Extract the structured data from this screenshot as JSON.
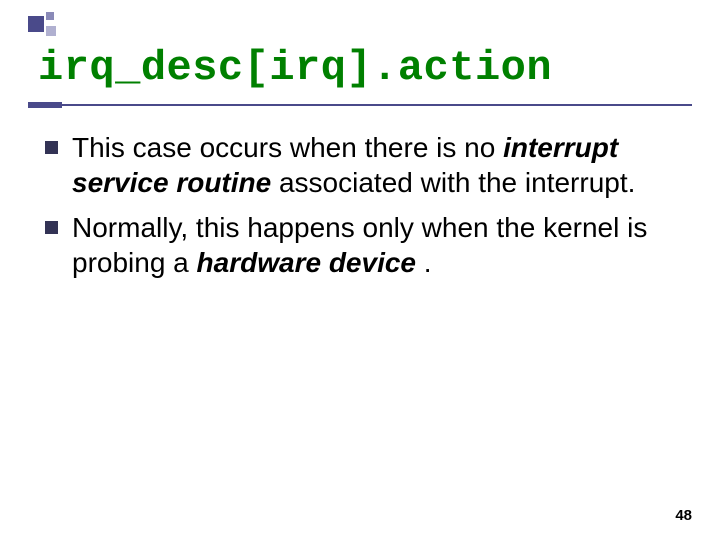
{
  "title": "irq_desc[irq].action",
  "bullets": [
    {
      "pre": "This case occurs when there is no ",
      "em": "interrupt service routine",
      "post": " associated with the interrupt."
    },
    {
      "pre": "Normally, this happens only when the kernel is probing a ",
      "em": "hardware device",
      "post": "."
    }
  ],
  "page_number": "48"
}
